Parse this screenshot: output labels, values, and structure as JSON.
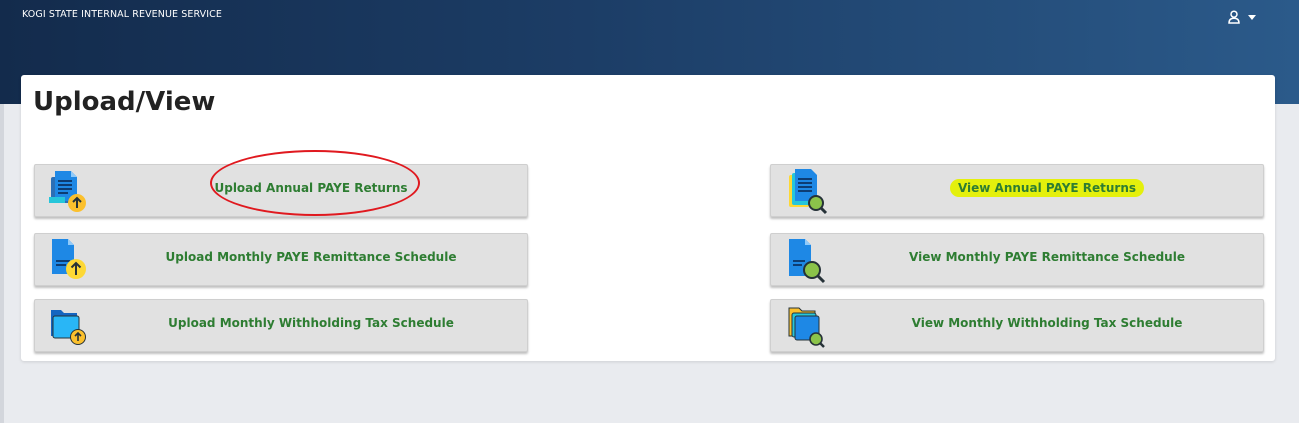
{
  "header": {
    "brand": "KOGI STATE INTERNAL REVENUE SERVICE",
    "user_icon": "user-icon",
    "dropdown_icon": "caret-down-icon"
  },
  "page": {
    "title": "Upload/View"
  },
  "tiles": {
    "upload_annual": {
      "label": "Upload Annual PAYE Returns",
      "icon": "document-upload-icon"
    },
    "upload_monthly_paye": {
      "label": "Upload Monthly PAYE Remittance Schedule",
      "icon": "document-upload-icon"
    },
    "upload_monthly_wht": {
      "label": "Upload Monthly Withholding Tax Schedule",
      "icon": "folder-upload-icon"
    },
    "view_annual": {
      "label": "View Annual PAYE Returns",
      "icon": "document-search-icon"
    },
    "view_monthly_paye": {
      "label": "View Monthly PAYE Remittance Schedule",
      "icon": "document-search-icon"
    },
    "view_monthly_wht": {
      "label": "View Monthly Withholding Tax Schedule",
      "icon": "folder-search-icon"
    }
  },
  "colors": {
    "header_dark": "#132b4c",
    "header_light": "#2b5a8a",
    "label_green": "#2e7d32",
    "highlight_yellow": "#e4f00c",
    "annotation_red": "#e0191f"
  }
}
